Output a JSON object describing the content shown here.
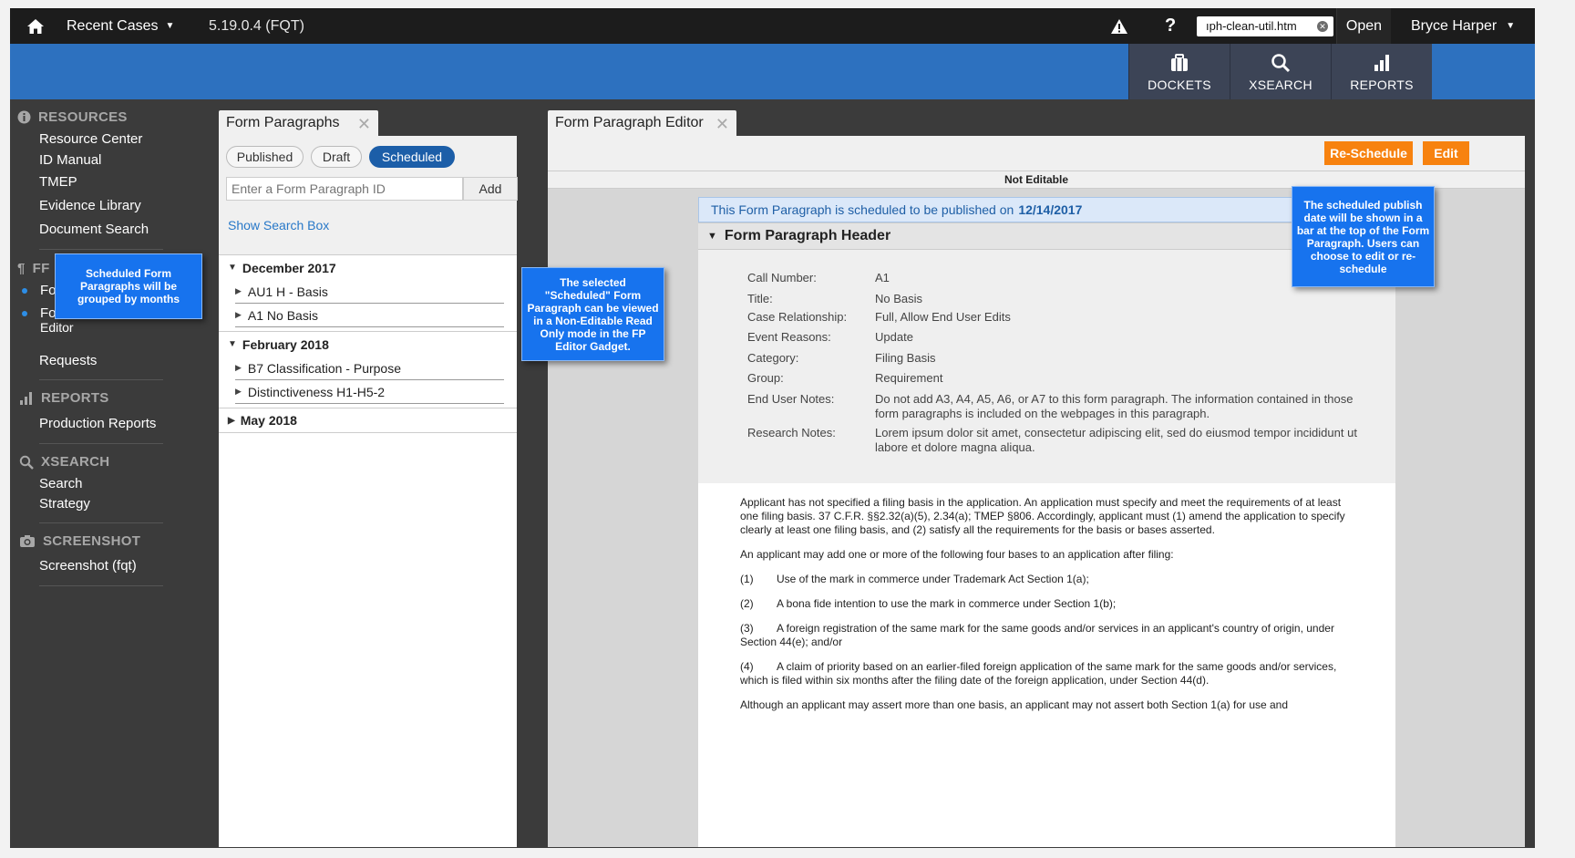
{
  "topbar": {
    "recent_cases": "Recent Cases",
    "version": "5.19.0.4 (FQT)",
    "url_value": "ıph-clean-util.htm",
    "open": "Open",
    "user": "Bryce Harper"
  },
  "nav": {
    "dockets": "DOCKETS",
    "xsearch": "XSEARCH",
    "reports": "REPORTS"
  },
  "sidebar": {
    "resources_header": "RESOURCES",
    "resources": [
      "Resource Center",
      "ID Manual",
      "TMEP",
      "Evidence Library",
      "Document Search"
    ],
    "fp_header": "FF",
    "fp_items": [
      "Fo",
      "Fo",
      "Editor"
    ],
    "requests": "Requests",
    "reports_header": "REPORTS",
    "reports_items": [
      "Production Reports"
    ],
    "xsearch_header": "XSEARCH",
    "xsearch_items": [
      "Search",
      "Strategy"
    ],
    "screenshot_header": "SCREENSHOT",
    "screenshot_items": [
      "Screenshot (fqt)"
    ]
  },
  "left_pane": {
    "tab_title": "Form Paragraphs",
    "filters": [
      "Published",
      "Draft",
      "Scheduled"
    ],
    "active_filter": "Scheduled",
    "input_placeholder": "Enter a Form Paragraph ID",
    "add": "Add",
    "show_search": "Show Search Box",
    "groups": [
      {
        "month": "December 2017",
        "items": [
          "AU1 H - Basis",
          "A1 No Basis"
        ]
      },
      {
        "month": "February 2018",
        "items": [
          "B7 Classification - Purpose",
          "Distinctiveness H1-H5-2"
        ]
      },
      {
        "month": "May 2018",
        "items": []
      }
    ]
  },
  "right_pane": {
    "tab_title": "Form Paragraph Editor",
    "reschedule": "Re-Schedule",
    "edit": "Edit",
    "not_editable": "Not Editable",
    "schedule_text": "This Form Paragraph is scheduled to be published on",
    "schedule_date": "12/14/2017",
    "header_title": "Form Paragraph Header",
    "meta": [
      {
        "k": "Call Number:",
        "v": "A1"
      },
      {
        "k": "Title:",
        "v": "No Basis"
      },
      {
        "k": "Case Relationship:",
        "v": "Full, Allow End User Edits"
      },
      {
        "k": "Event Reasons:",
        "v": "Update"
      },
      {
        "k": "Category:",
        "v": "Filing Basis"
      },
      {
        "k": "Group:",
        "v": "Requirement"
      },
      {
        "k": "End User Notes:",
        "v": "Do not add A3, A4, A5, A6, or A7 to this form paragraph.  The information contained in those form paragraphs is included on the webpages in this paragraph."
      },
      {
        "k": "Research Notes:",
        "v": "Lorem ipsum dolor sit amet, consectetur adipiscing elit, sed do eiusmod tempor incididunt ut labore et dolore magna aliqua."
      }
    ],
    "para1": "Applicant has not specified a filing basis in the application. An application must specify and meet the requirements of at least one filing basis. 37 C.F.R. §§2.32(a)(5), 2.34(a); TMEP §806. Accordingly, applicant must (1) amend the application to specify clearly at least one filing basis, and (2) satisfy all the requirements for the basis or bases asserted.",
    "para2": "An applicant may add one or more of the following four bases to an application after filing:",
    "list": [
      {
        "n": "(1)",
        "t": "Use of the mark in commerce under Trademark Act Section 1(a);"
      },
      {
        "n": "(2)",
        "t": "A bona fide intention to use the mark in commerce under Section 1(b);"
      },
      {
        "n": "(3)",
        "t": "A foreign registration of the same mark for the same goods and/or services in an applicant's country of origin, under Section 44(e); and/or"
      },
      {
        "n": "(4)",
        "t": "A claim of priority based on an earlier-filed foreign application of the same mark for the same goods and/or services, which is filed within six months after the filing date of the foreign application, under Section 44(d)."
      }
    ],
    "para3": "Although an applicant may assert more than one basis, an applicant may not assert both Section 1(a) for use and"
  },
  "callouts": {
    "grouped": "Scheduled Form Paragraphs will be grouped by months",
    "selected": "The selected \"Scheduled\" Form Paragraph can be viewed in a Non-Editable Read Only mode in the FP Editor Gadget.",
    "publish": "The scheduled publish date will be shown in a bar at the top of the Form Paragraph. Users can choose to edit or re-schedule"
  },
  "colors": {
    "accent_blue": "#2d71bf",
    "active_pill": "#1c5ea8",
    "orange_button": "#f7820f",
    "callout_blue": "#1773ee"
  }
}
